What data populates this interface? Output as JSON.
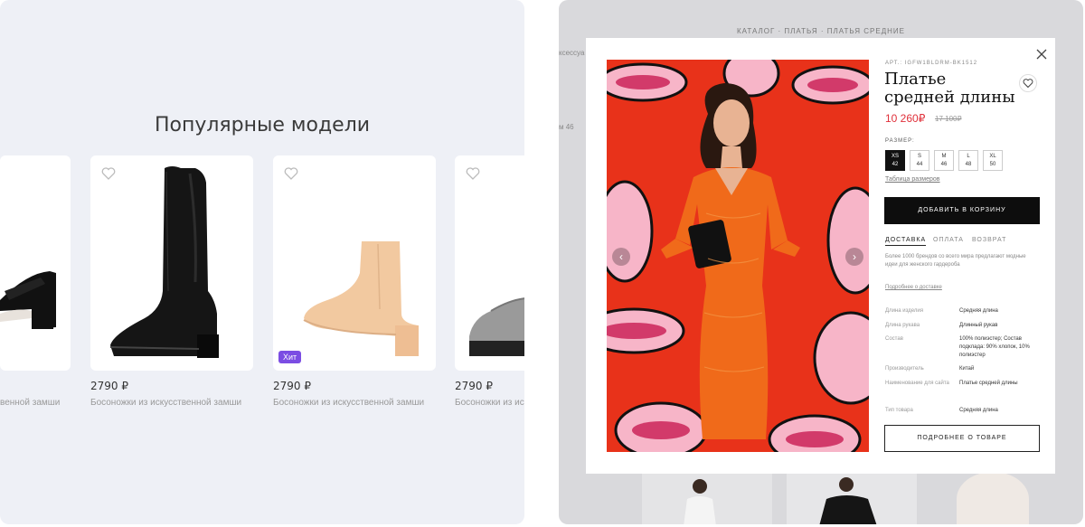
{
  "popular": {
    "title": "Популярные модели",
    "cards": [
      {
        "price": "2790 ₽",
        "desc": "Босоножки из искусственной замши",
        "badge": ""
      },
      {
        "price": "2790 ₽",
        "desc": "Босоножки из искусственной замши",
        "badge": "Хит"
      },
      {
        "price": "2790 ₽",
        "desc": "Босоножки из искус"
      }
    ],
    "partial_desc_left": "венной замши"
  },
  "page": {
    "breadcrumb": "КАТАЛОГ · ПЛАТЬЯ · ПЛАТЬЯ СРЕДНИЕ",
    "side_labels": [
      "ксессуа",
      "м 46"
    ]
  },
  "product": {
    "sku": "АРТ.: IGFW1BLDRM-BK1512",
    "title": "Платье средней длины",
    "price": "10 260₽",
    "old_price": "17 100₽",
    "size_label": "РАЗМЕР:",
    "sizes": [
      {
        "name": "XS",
        "num": "42",
        "selected": true
      },
      {
        "name": "S",
        "num": "44",
        "selected": false
      },
      {
        "name": "M",
        "num": "46",
        "selected": false
      },
      {
        "name": "L",
        "num": "48",
        "selected": false
      },
      {
        "name": "XL",
        "num": "50",
        "selected": false
      }
    ],
    "size_table": "Таблица размеров",
    "add_to_cart": "ДОБАВИТЬ В КОРЗИНУ",
    "tabs": [
      "ДОСТАВКА",
      "ОПЛАТА",
      "ВОЗВРАТ"
    ],
    "shipping_text": "Более 1000 брендов со всего мира предлагают модные идеи для женского гардероба",
    "shipping_more": "Подробнее о доставке",
    "attributes": [
      {
        "key": "Длина изделия",
        "value": "Средняя длина"
      },
      {
        "key": "Длина рукава",
        "value": "Длинный рукав"
      },
      {
        "key": "Состав",
        "value": "100% полиэстер; Состав подклада: 90% хлопок, 10% полиэстер"
      },
      {
        "key": "Производитель",
        "value": "Китай"
      },
      {
        "key": "Наименование для сайта",
        "value": "Платье средней длины"
      },
      {
        "key": "Тип товара",
        "value": "Средняя длина"
      }
    ],
    "more_button": "ПОДРОБНЕЕ О ТОВАРЕ"
  },
  "colors": {
    "accent_price": "#e0303a",
    "badge": "#7b4de3",
    "photo_bg": "#e8321a",
    "dress": "#f06a1a"
  }
}
